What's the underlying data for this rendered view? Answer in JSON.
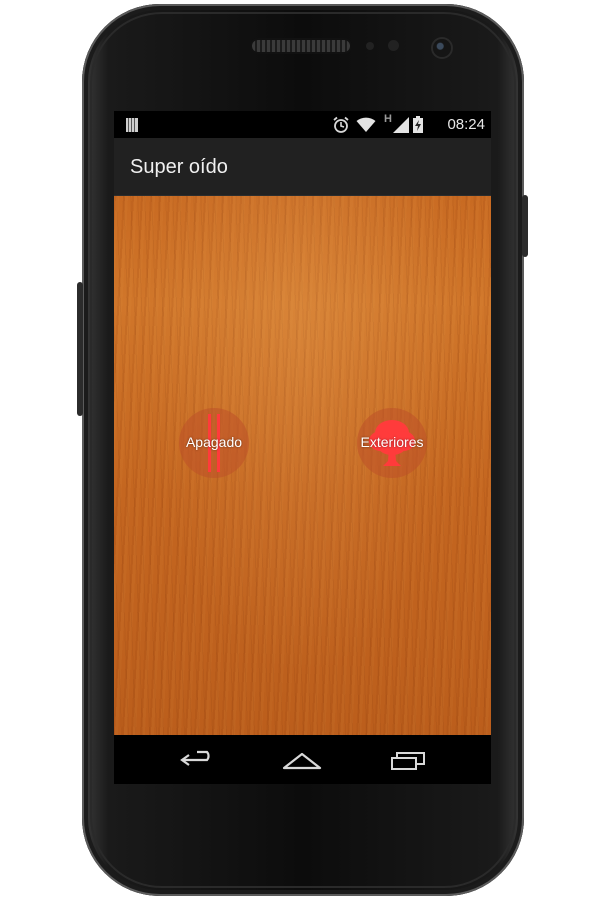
{
  "status_bar": {
    "time": "08:24",
    "network_label": "H",
    "icons": [
      "notification-icon",
      "alarm-icon",
      "wifi-icon",
      "signal-icon",
      "battery-icon"
    ]
  },
  "app": {
    "title": "Super oído"
  },
  "modes": [
    {
      "label": "Apagado",
      "icon": "off-bars-icon"
    },
    {
      "label": "Exteriores",
      "icon": "tree-icon"
    }
  ],
  "navigation": {
    "buttons": [
      "back",
      "home",
      "recent-apps"
    ]
  },
  "colors": {
    "accent": "#ff3b3b",
    "action_bar": "#212121",
    "wood": "#c86a22"
  }
}
